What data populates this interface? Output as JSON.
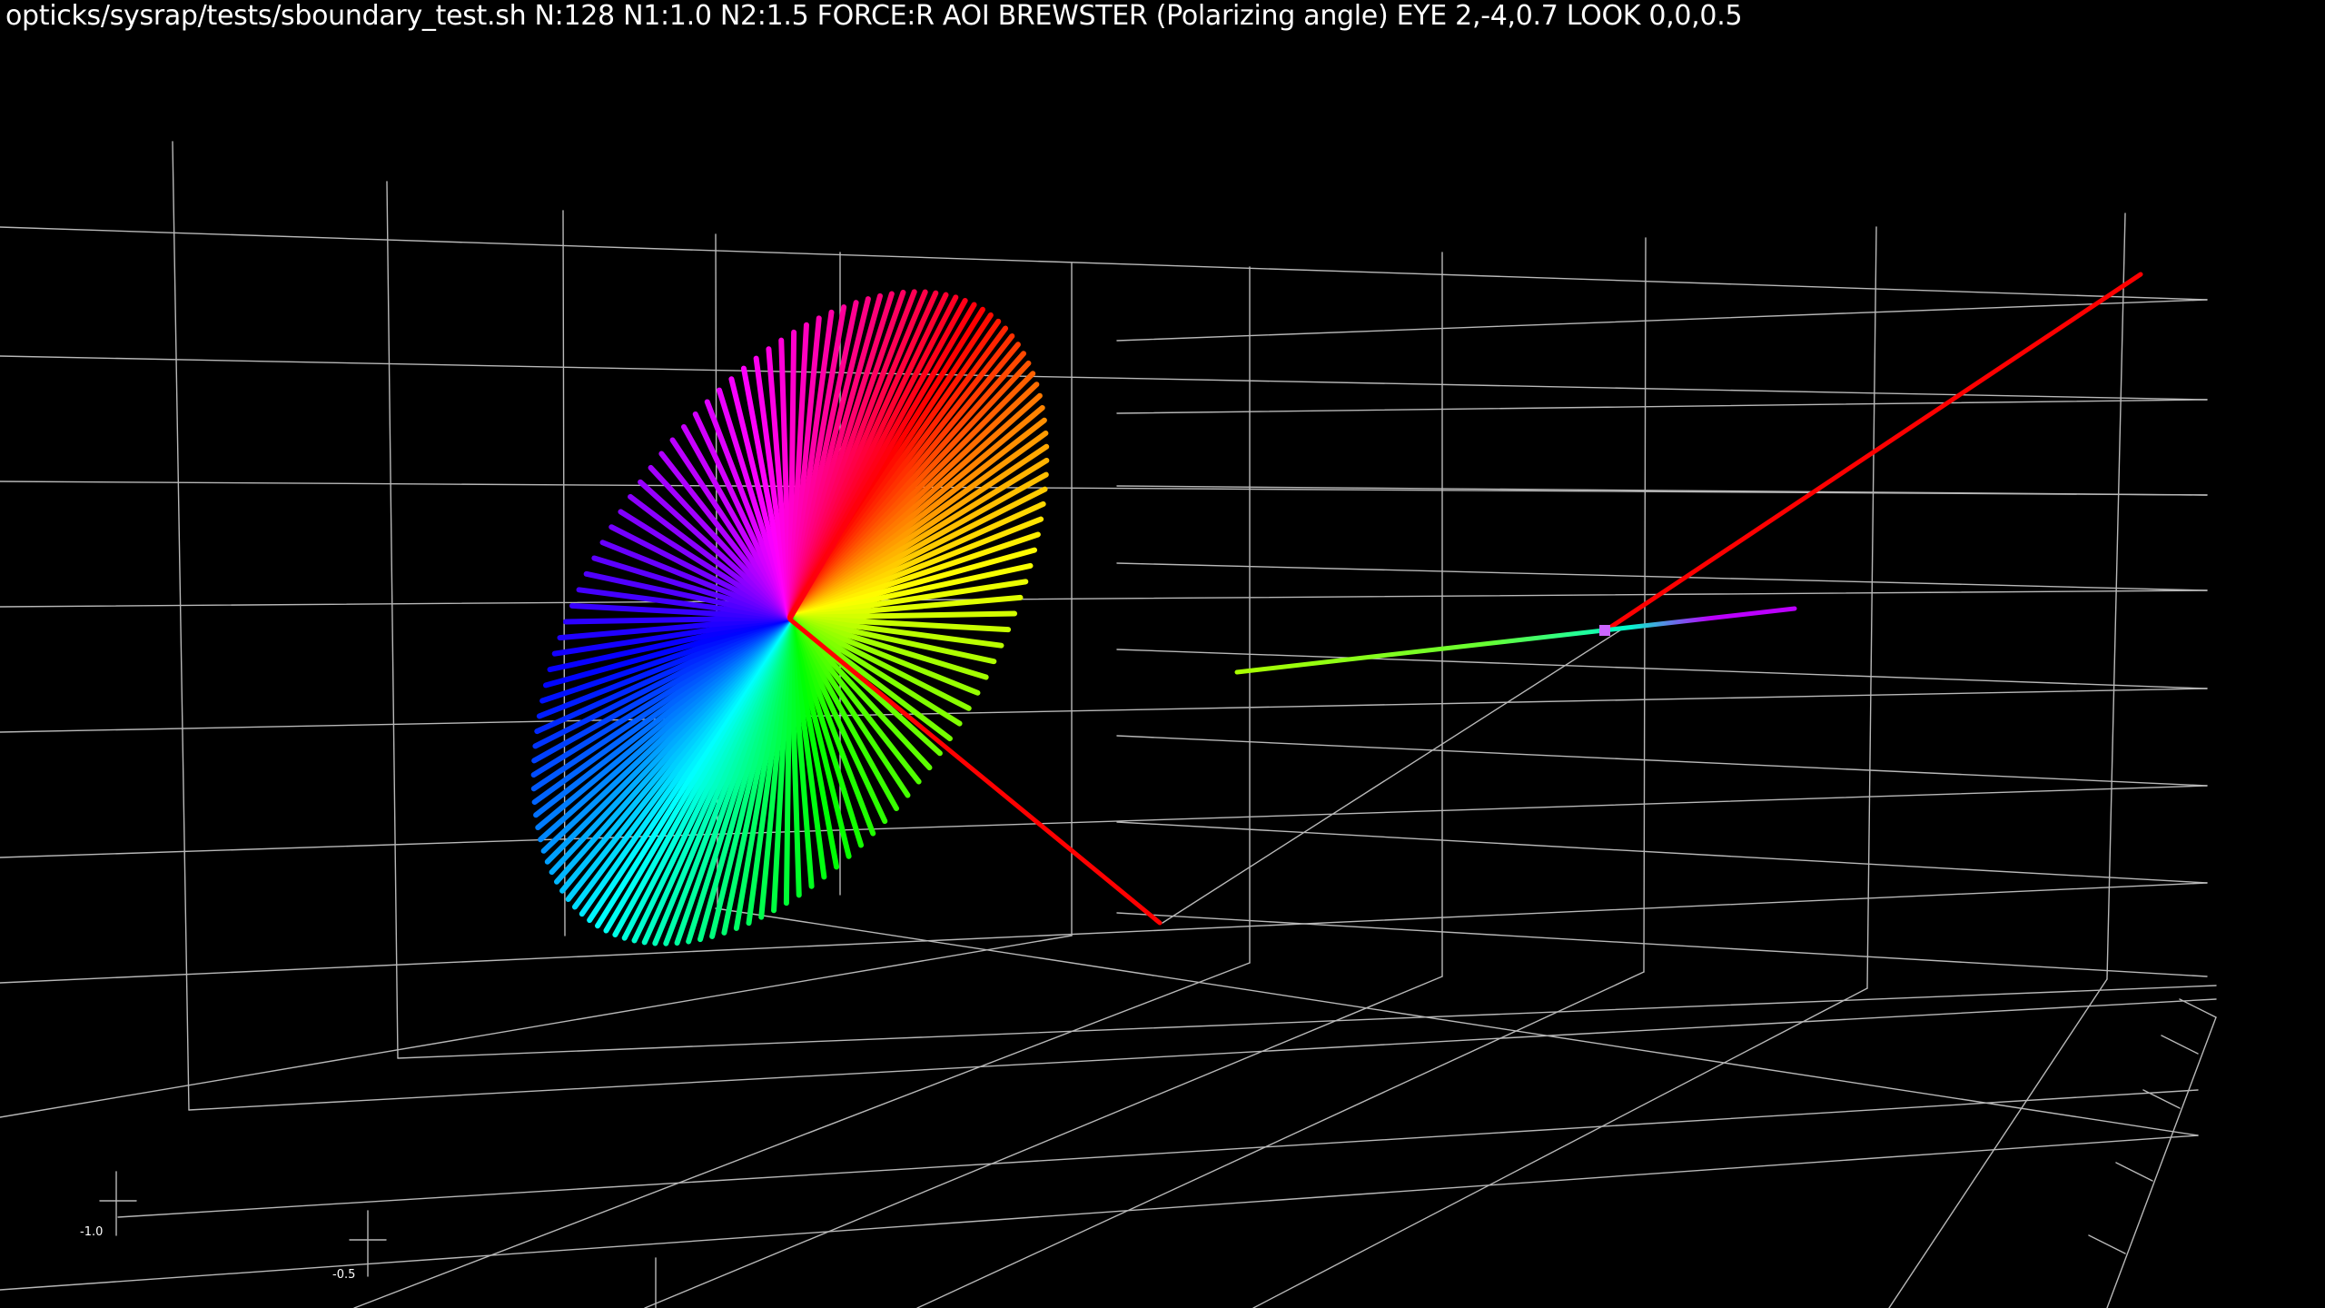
{
  "window": {
    "title": "opticks/sysrap/tests/sboundary_test.sh N:128 N1:1.0 N2:1.5 FORCE:R AOI BREWSTER  (Polarizing angle) EYE 2,-4,0.7 LOOK 0,0,0.5"
  },
  "scene": {
    "background": "#000000",
    "grid_color": "#b8b8b8",
    "ray_color": "#ff0000",
    "polarization_vector_count": 128,
    "axis_tick_labels": [
      "-1.0",
      "-0.5"
    ]
  }
}
